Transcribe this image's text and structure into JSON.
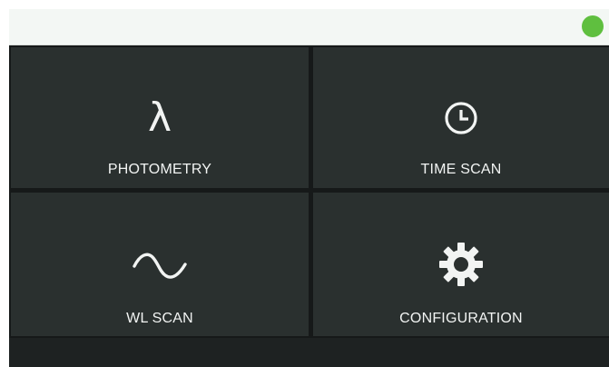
{
  "status": {
    "indicator_color": "#5fbf3f",
    "indicator_icon": "status-dot"
  },
  "menu": {
    "tiles": [
      {
        "label": "PHOTOMETRY",
        "icon": "lambda-icon",
        "glyph": "λ"
      },
      {
        "label": "TIME SCAN",
        "icon": "clock-icon"
      },
      {
        "label": "WL SCAN",
        "icon": "sine-wave-icon"
      },
      {
        "label": "CONFIGURATION",
        "icon": "gear-icon"
      }
    ]
  },
  "colors": {
    "tile_background": "#2a302f",
    "text": "#f2f4f3",
    "top_bar": "#f3f7f4"
  }
}
